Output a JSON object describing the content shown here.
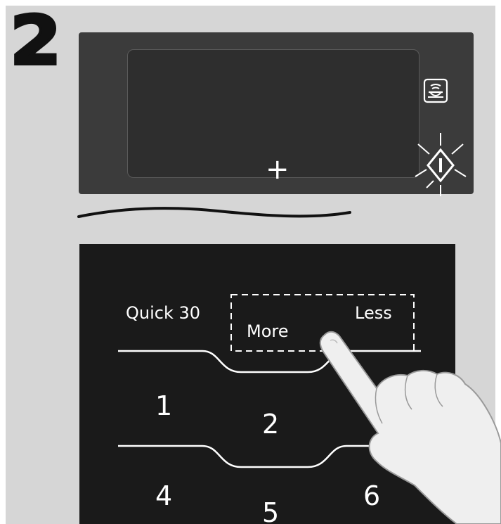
{
  "step": {
    "number": "2"
  },
  "oven_panel": {
    "plus_symbol": "+",
    "icons": {
      "sensor": "sensor-cook-icon",
      "start": "start-button-icon"
    }
  },
  "control_panel": {
    "quick_label": "Quick 30",
    "more_label": "More",
    "less_label": "Less",
    "keys": [
      "1",
      "2",
      "4",
      "5",
      "6"
    ]
  },
  "hand": {
    "icon": "pointing-hand-icon"
  }
}
